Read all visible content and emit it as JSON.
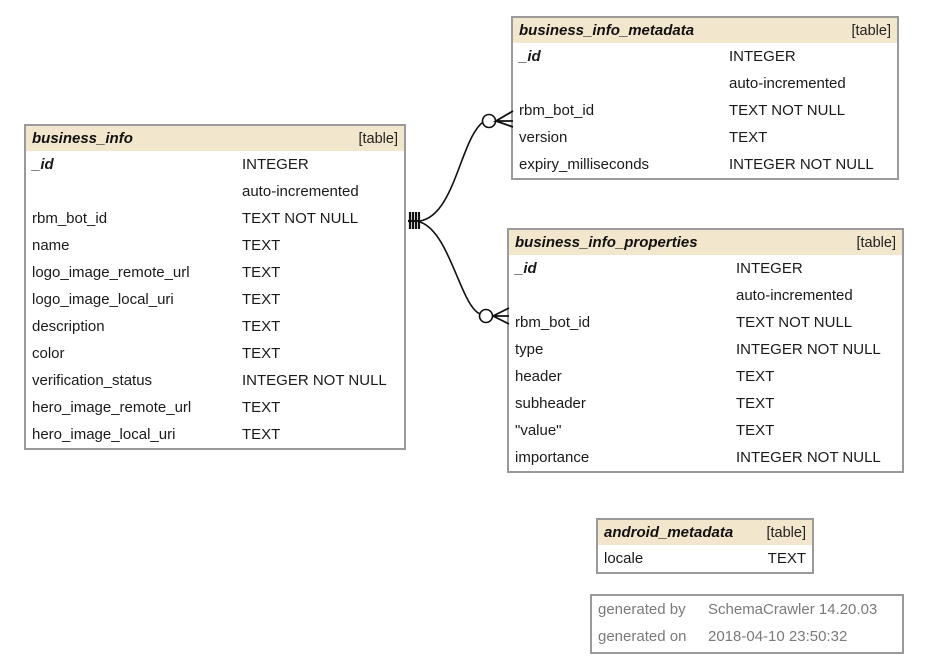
{
  "tables": {
    "business_info": {
      "name": "business_info",
      "kind": "[table]",
      "columns": [
        {
          "name": "_id",
          "type": "INTEGER",
          "pk": true
        },
        {
          "name": "",
          "type": "auto-incremented"
        },
        {
          "name": "rbm_bot_id",
          "type": "TEXT NOT NULL"
        },
        {
          "name": "name",
          "type": "TEXT"
        },
        {
          "name": "logo_image_remote_url",
          "type": "TEXT"
        },
        {
          "name": "logo_image_local_uri",
          "type": "TEXT"
        },
        {
          "name": "description",
          "type": "TEXT"
        },
        {
          "name": "color",
          "type": "TEXT"
        },
        {
          "name": "verification_status",
          "type": "INTEGER NOT NULL"
        },
        {
          "name": "hero_image_remote_url",
          "type": "TEXT"
        },
        {
          "name": "hero_image_local_uri",
          "type": "TEXT"
        }
      ]
    },
    "business_info_metadata": {
      "name": "business_info_metadata",
      "kind": "[table]",
      "columns": [
        {
          "name": "_id",
          "type": "INTEGER",
          "pk": true
        },
        {
          "name": "",
          "type": "auto-incremented"
        },
        {
          "name": "rbm_bot_id",
          "type": "TEXT NOT NULL"
        },
        {
          "name": "version",
          "type": "TEXT"
        },
        {
          "name": "expiry_milliseconds",
          "type": "INTEGER NOT NULL"
        }
      ]
    },
    "business_info_properties": {
      "name": "business_info_properties",
      "kind": "[table]",
      "columns": [
        {
          "name": "_id",
          "type": "INTEGER",
          "pk": true
        },
        {
          "name": "",
          "type": "auto-incremented"
        },
        {
          "name": "rbm_bot_id",
          "type": "TEXT NOT NULL"
        },
        {
          "name": "type",
          "type": "INTEGER NOT NULL"
        },
        {
          "name": "header",
          "type": "TEXT"
        },
        {
          "name": "subheader",
          "type": "TEXT"
        },
        {
          "name": "\"value\"",
          "type": "TEXT"
        },
        {
          "name": "importance",
          "type": "INTEGER NOT NULL"
        }
      ]
    },
    "android_metadata": {
      "name": "android_metadata",
      "kind": "[table]",
      "columns": [
        {
          "name": "locale",
          "type": "TEXT"
        }
      ]
    }
  },
  "relationships": [
    {
      "from": "business_info.rbm_bot_id",
      "to": "business_info_metadata.rbm_bot_id",
      "from_cardinality": "one-and-only-one",
      "to_cardinality": "zero-or-many"
    },
    {
      "from": "business_info.rbm_bot_id",
      "to": "business_info_properties.rbm_bot_id",
      "from_cardinality": "one-and-only-one",
      "to_cardinality": "zero-or-many"
    }
  ],
  "footer": {
    "generated_by_label": "generated by",
    "generated_by_value": "SchemaCrawler 14.20.03",
    "generated_on_label": "generated on",
    "generated_on_value": "2018-04-10 23:50:32"
  },
  "colors": {
    "header_bg": "#f2e6cc",
    "border": "#9a9a9a",
    "footer_text": "#7a7a7a"
  }
}
